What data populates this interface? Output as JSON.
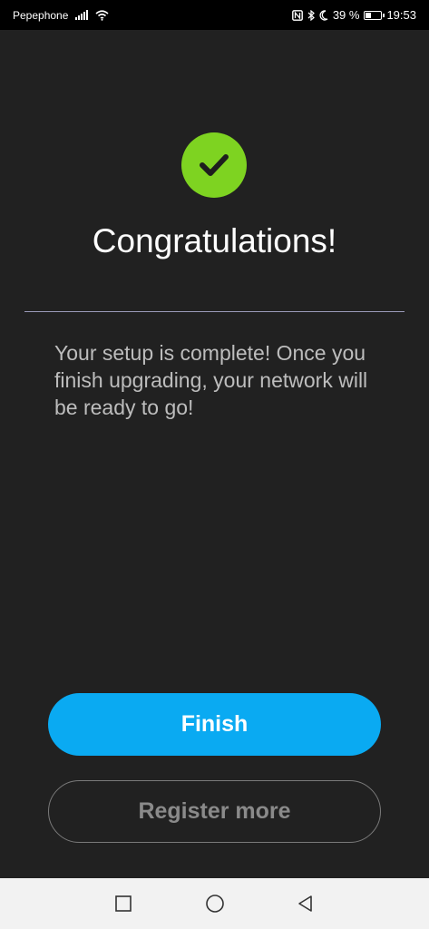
{
  "status_bar": {
    "carrier": "Pepephone",
    "battery_percent": "39 %",
    "battery_level": 0.39,
    "time": "19:53",
    "icons": [
      "signal-icon",
      "wifi-icon",
      "nfc-icon",
      "bluetooth-icon",
      "moon-icon",
      "battery-icon"
    ]
  },
  "main": {
    "icon": "check-circle-icon",
    "accent_color": "#7ed321",
    "title": "Congratulations!",
    "message": "Your setup is complete! Once you finish upgrading, your network will be ready to go!"
  },
  "actions": {
    "finish_label": "Finish",
    "finish_color": "#0aaaf2",
    "register_label": "Register more"
  },
  "nav_bar": {
    "icons": [
      "recent-apps-icon",
      "home-icon",
      "back-icon"
    ]
  }
}
